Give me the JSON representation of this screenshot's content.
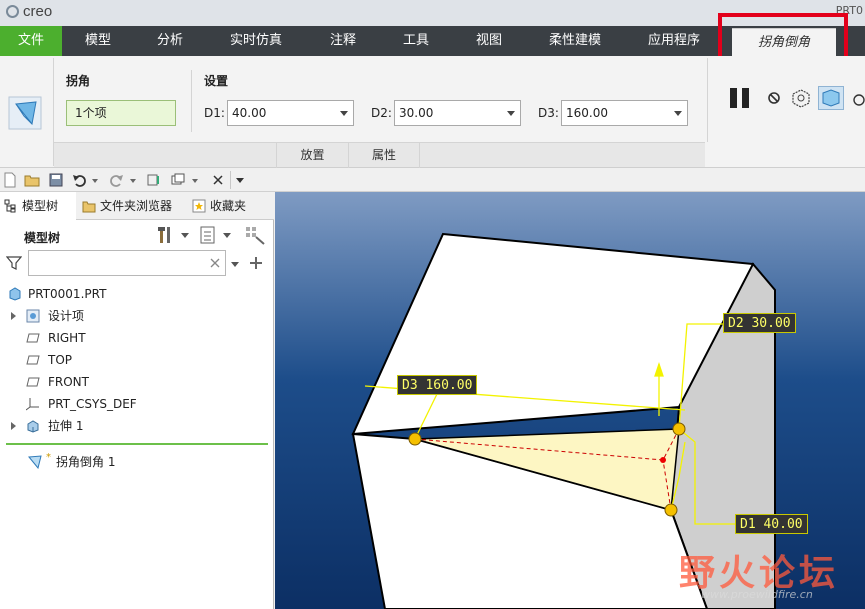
{
  "app": {
    "logo_text": "creo",
    "part_name": "PRT0"
  },
  "tabs": [
    "文件",
    "模型",
    "分析",
    "实时仿真",
    "注释",
    "工具",
    "视图",
    "柔性建模",
    "应用程序",
    "拐角倒角"
  ],
  "ribbon": {
    "group_corner": "拐角",
    "selection_value": "1个项",
    "group_settings": "设置",
    "d1_label": "D1:",
    "d1_value": "40.00",
    "d2_label": "D2:",
    "d2_value": "30.00",
    "d3_label": "D3:",
    "d3_value": "160.00",
    "panel_tabs": [
      "放置",
      "属性"
    ]
  },
  "left_panel": {
    "tabs": [
      "模型树",
      "文件夹浏览器",
      "收藏夹"
    ],
    "tree_header": "模型树",
    "filter_placeholder": "",
    "items": [
      {
        "label": "PRT0001.PRT"
      },
      {
        "label": "设计项"
      },
      {
        "label": "RIGHT"
      },
      {
        "label": "TOP"
      },
      {
        "label": "FRONT"
      },
      {
        "label": "PRT_CSYS_DEF"
      },
      {
        "label": "拉伸 1"
      },
      {
        "label": "拐角倒角 1"
      }
    ]
  },
  "viewport": {
    "dims": [
      {
        "label": "D2 30.00"
      },
      {
        "label": "D3 160.00"
      },
      {
        "label": "D1 40.00"
      }
    ],
    "watermark": "野火论坛",
    "watermark_url": "www.proewildfire.cn"
  },
  "colors": {
    "file_tab": "#4caf2e",
    "highlight": "#e3001b",
    "dim_text": "#ffff66"
  }
}
